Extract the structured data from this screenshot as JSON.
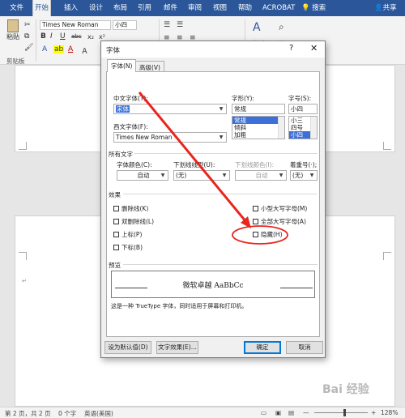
{
  "ribbon_tabs": [
    "文件",
    "开始",
    "插入",
    "设计",
    "布局",
    "引用",
    "邮件",
    "审阅",
    "视图",
    "帮助",
    "ACROBAT"
  ],
  "search_label": "搜索",
  "share_label": "共享",
  "ribbon": {
    "paste_label": "粘贴",
    "clipboard_label": "剪贴板",
    "font_name": "Times New Roman",
    "font_size": "小四",
    "fmt_buttons": [
      "B",
      "I",
      "U",
      "abc",
      "x₂",
      "x²"
    ],
    "editing_label": "编辑",
    "styles_label": "样式"
  },
  "dialog": {
    "title": "字体",
    "help": "?",
    "close": "✕",
    "tabs": [
      "字体(N)",
      "高级(V)"
    ],
    "chinese_font_label": "中文字体(T):",
    "chinese_font_value": "宋体",
    "style_label": "字形(Y):",
    "style_value": "常规",
    "style_options": [
      "常规",
      "倾斜",
      "加粗"
    ],
    "size_label": "字号(S):",
    "size_value": "小四",
    "size_options": [
      "小三",
      "四号",
      "小四"
    ],
    "western_font_label": "西文字体(F):",
    "western_font_value": "Times New Roman",
    "all_text_label": "所有文字",
    "font_color_label": "字体颜色(C):",
    "font_color_value": "自动",
    "underline_label": "下划线线型(U):",
    "underline_value": "(无)",
    "underline_color_label": "下划线颜色(I):",
    "underline_color_value": "自动",
    "emphasis_label": "着重号(·);",
    "emphasis_value": "(无)",
    "effects_label": "效果",
    "effects_left": [
      "删除线(K)",
      "双删除线(L)",
      "上标(P)",
      "下标(B)"
    ],
    "effects_right": [
      "小型大写字母(M)",
      "全部大写字母(A)",
      "隐藏(H)"
    ],
    "preview_label": "预览",
    "preview_text": "微软卓越 AaBbCc",
    "note": "这是一种 TrueType 字体，同时适用于屏幕和打印机。",
    "set_default": "设为默认值(D)",
    "text_effects": "文字效果(E)...",
    "ok": "确定",
    "cancel": "取消"
  },
  "status": {
    "page": "第 2 页，共 2 页",
    "words": "0 个字",
    "lang": "英语(美国)",
    "zoom_minus": "—",
    "zoom_plus": "+",
    "zoom": "128%"
  },
  "watermark": "Bai 经验",
  "colors": {
    "accent": "#2b579a",
    "annotation": "#e8261e",
    "selection": "#3c6fd8"
  }
}
